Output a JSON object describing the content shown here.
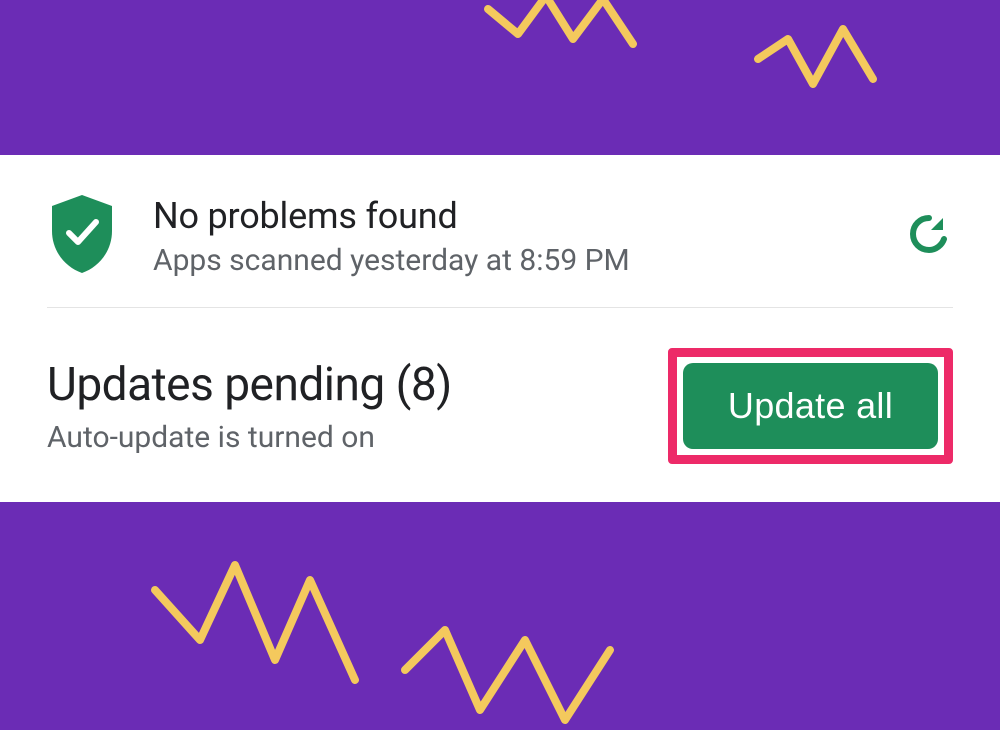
{
  "scan": {
    "title": "No problems found",
    "subtitle": "Apps scanned yesterday at 8:59 PM"
  },
  "updates": {
    "title": "Updates pending (8)",
    "subtitle": "Auto-update is turned on",
    "button_label": "Update all"
  },
  "colors": {
    "background": "#6b2cb5",
    "accent_green": "#1e8e5a",
    "highlight_pink": "#ed2a68",
    "zigzag_yellow": "#f4c95d"
  }
}
